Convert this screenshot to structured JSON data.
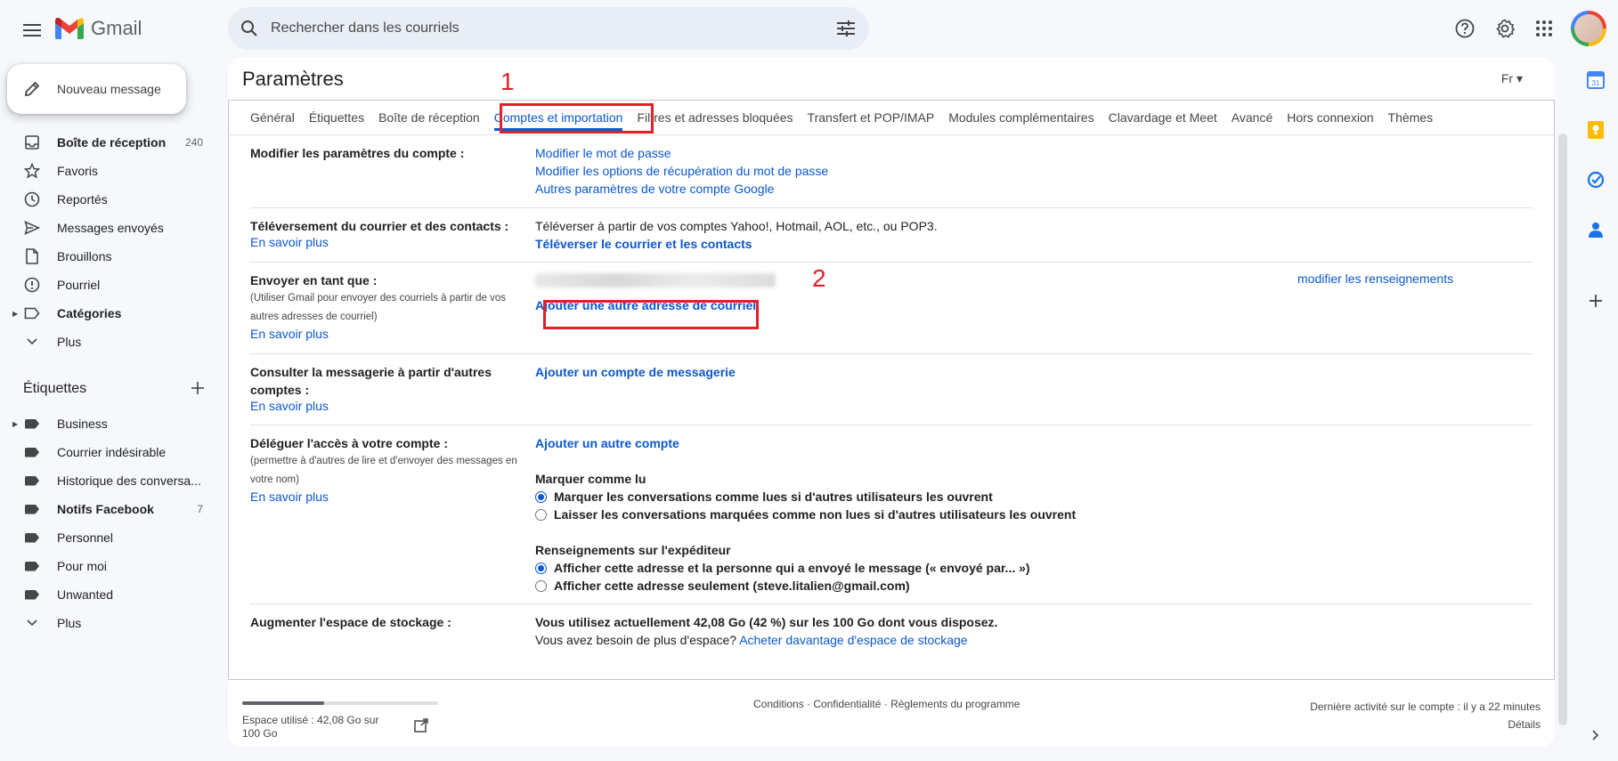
{
  "app": {
    "name": "Gmail"
  },
  "search": {
    "placeholder": "Rechercher dans les courriels"
  },
  "compose": {
    "label": "Nouveau message"
  },
  "sidebar": {
    "items": [
      {
        "label": "Boîte de réception",
        "count": "240",
        "bold": true,
        "icon": "inbox-icon"
      },
      {
        "label": "Favoris",
        "icon": "star-icon"
      },
      {
        "label": "Reportés",
        "icon": "clock-icon"
      },
      {
        "label": "Messages envoyés",
        "icon": "send-icon"
      },
      {
        "label": "Brouillons",
        "icon": "draft-icon"
      },
      {
        "label": "Pourriel",
        "icon": "spam-icon"
      },
      {
        "label": "Catégories",
        "bold": true,
        "icon": "label-icon"
      },
      {
        "label": "Plus",
        "icon": "chevron-down-icon"
      }
    ],
    "labels_heading": "Étiquettes",
    "labels": [
      {
        "label": "Business",
        "expandable": true
      },
      {
        "label": "Courrier indésirable"
      },
      {
        "label": "Historique des conversa..."
      },
      {
        "label": "Notifs Facebook",
        "count": "7",
        "bold": true
      },
      {
        "label": "Personnel"
      },
      {
        "label": "Pour moi"
      },
      {
        "label": "Unwanted"
      }
    ],
    "labels_more": "Plus"
  },
  "settings": {
    "title": "Paramètres",
    "lang": "Fr",
    "tabs": [
      "Général",
      "Étiquettes",
      "Boîte de réception",
      "Comptes et importation",
      "Filtres et adresses bloquées",
      "Transfert et POP/IMAP",
      "Modules complémentaires",
      "Clavardage et Meet",
      "Avancé",
      "Hors connexion",
      "Thèmes"
    ],
    "active_tab": "Comptes et importation",
    "rows": {
      "account": {
        "title": "Modifier les paramètres du compte :",
        "links": [
          "Modifier le mot de passe",
          "Modifier les options de récupération du mot de passe",
          "Autres paramètres de votre compte Google"
        ]
      },
      "import": {
        "title": "Téléversement du courrier et des contacts :",
        "learn": "En savoir plus",
        "text": "Téléverser à partir de vos comptes Yahoo!, Hotmail, AOL, etc., ou POP3.",
        "action": "Téléverser le courrier et les contacts"
      },
      "sendas": {
        "title": "Envoyer en tant que :",
        "sub": "(Utiliser Gmail pour envoyer des courriels à partir de vos autres adresses de courriel)",
        "learn": "En savoir plus",
        "edit": "modifier les renseignements",
        "action": "Ajouter une autre adresse de courriel"
      },
      "check": {
        "title": "Consulter la messagerie à partir d'autres comptes :",
        "learn": "En savoir plus",
        "action": "Ajouter un compte de messagerie"
      },
      "delegate": {
        "title": "Déléguer l'accès à votre compte :",
        "sub": "(permettre à d'autres de lire et d'envoyer des messages en votre nom)",
        "learn": "En savoir plus",
        "action": "Ajouter un autre compte",
        "mark_title": "Marquer comme lu",
        "mark_opt1": "Marquer les conversations comme lues si d'autres utilisateurs les ouvrent",
        "mark_opt2": "Laisser les conversations marquées comme non lues si d'autres utilisateurs les ouvrent",
        "sender_title": "Renseignements sur l'expéditeur",
        "sender_opt1": "Afficher cette adresse et la personne qui a envoyé le message (« envoyé par... »)",
        "sender_opt2": "Afficher cette adresse seulement (steve.litalien@gmail.com)"
      },
      "storage": {
        "title": "Augmenter l'espace de stockage :",
        "line1": "Vous utilisez actuellement 42,08 Go (42 %) sur les 100 Go dont vous disposez.",
        "line2": "Vous avez besoin de plus d'espace?",
        "link": "Acheter davantage d'espace de stockage"
      }
    }
  },
  "annotations": {
    "step1": "1",
    "step2": "2"
  },
  "footer": {
    "storage_used_fraction": 0.42,
    "storage_text": "Espace utilisé : 42,08 Go sur 100 Go",
    "links": "Conditions · Confidentialité · Règlements du programme",
    "activity": "Dernière activité sur le compte : il y a 22 minutes",
    "details": "Détails"
  },
  "colors": {
    "accent": "#0b57d0",
    "annotation": "#e3202a"
  }
}
